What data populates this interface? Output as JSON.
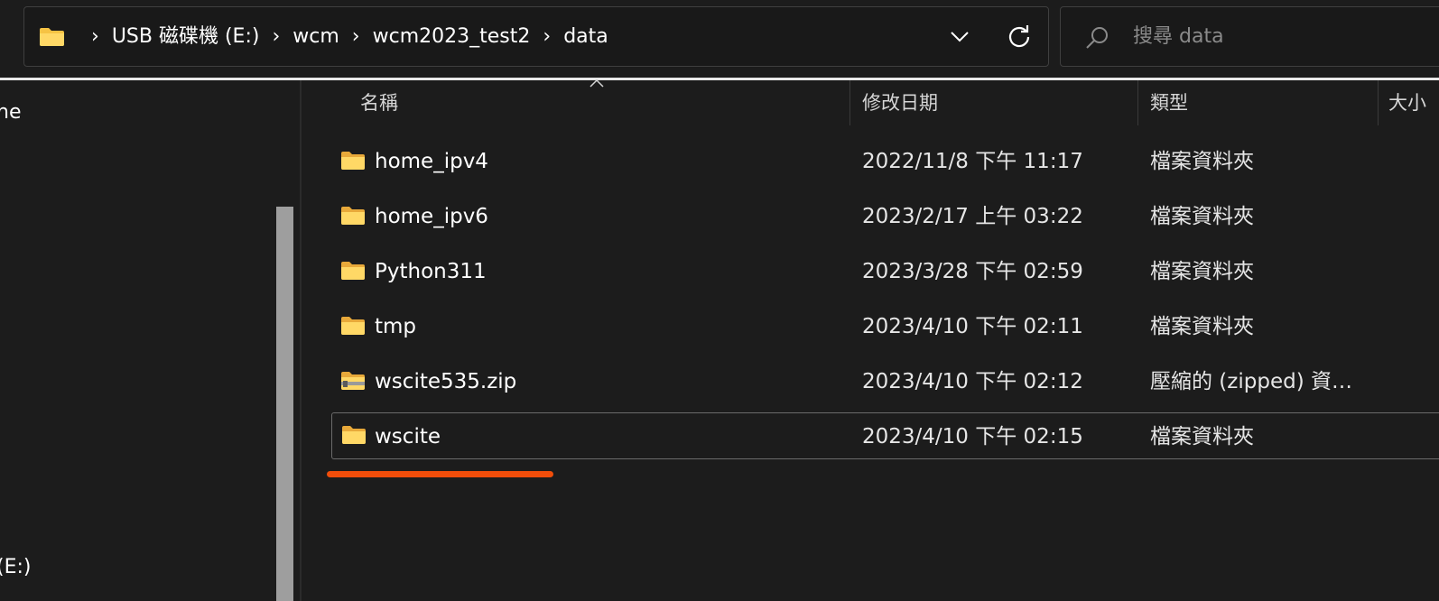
{
  "address_bar": {
    "breadcrumbs": [
      "USB 磁碟機 (E:)",
      "wcm",
      "wcm2023_test2",
      "data"
    ]
  },
  "search": {
    "placeholder": "搜尋 data"
  },
  "nav_pane": {
    "items": [
      {
        "label": "ne"
      },
      {
        "label": "(E:)"
      }
    ]
  },
  "columns": {
    "name": "名稱",
    "date": "修改日期",
    "type": "類型",
    "size": "大小"
  },
  "files": [
    {
      "name": "home_ipv4",
      "date": "2022/11/8 下午 11:17",
      "type": "檔案資料夾",
      "icon": "folder-icon",
      "selected": false
    },
    {
      "name": "home_ipv6",
      "date": "2023/2/17 上午 03:22",
      "type": "檔案資料夾",
      "icon": "folder-icon",
      "selected": false
    },
    {
      "name": "Python311",
      "date": "2023/3/28 下午 02:59",
      "type": "檔案資料夾",
      "icon": "folder-icon",
      "selected": false
    },
    {
      "name": "tmp",
      "date": "2023/4/10 下午 02:11",
      "type": "檔案資料夾",
      "icon": "folder-icon",
      "selected": false
    },
    {
      "name": "wscite535.zip",
      "date": "2023/4/10 下午 02:12",
      "type": "壓縮的 (zipped) 資…",
      "icon": "zip-folder-icon",
      "selected": false
    },
    {
      "name": "wscite",
      "date": "2023/4/10 下午 02:15",
      "type": "檔案資料夾",
      "icon": "folder-icon",
      "selected": true
    }
  ],
  "colors": {
    "background": "#1c1c1c",
    "folder": "#f6c344",
    "highlight_underline": "#f04d0a"
  }
}
